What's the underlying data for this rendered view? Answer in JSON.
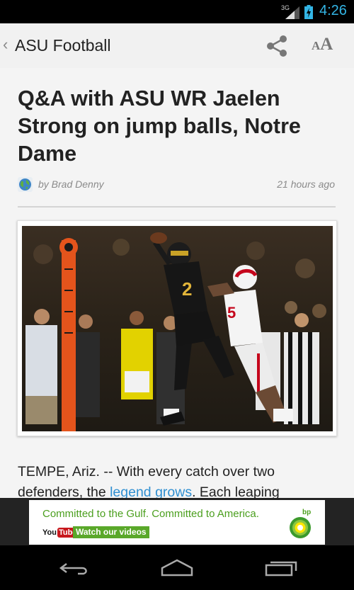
{
  "status_bar": {
    "network": "3G",
    "time": "4:26"
  },
  "app_bar": {
    "back_glyph": "‹",
    "title": "ASU Football",
    "share_icon": "share-icon",
    "font_size_icon": {
      "small": "A",
      "big": "A"
    }
  },
  "article": {
    "headline": "Q&A with ASU WR Jaelen Strong on jump balls, Notre Dame",
    "author": "by Brad Denny",
    "time_ago": "21 hours ago",
    "body_start": "TEMPE, Ariz. -- With every catch over two defenders, the ",
    "body_link": "legend grows",
    "body_end": ". Each leaping"
  },
  "ad": {
    "headline": "Committed to the Gulf. Committed to America.",
    "yt_you": "You",
    "yt_tube": "Tube",
    "cta": "Watch our videos",
    "brand_text": "bp"
  },
  "nav": {
    "back": "back-icon",
    "home": "home-icon",
    "recents": "recents-icon"
  },
  "colors": {
    "accent_blue": "#33b5e5",
    "link": "#2f8fd1",
    "ad_green": "#4b9f1e"
  }
}
